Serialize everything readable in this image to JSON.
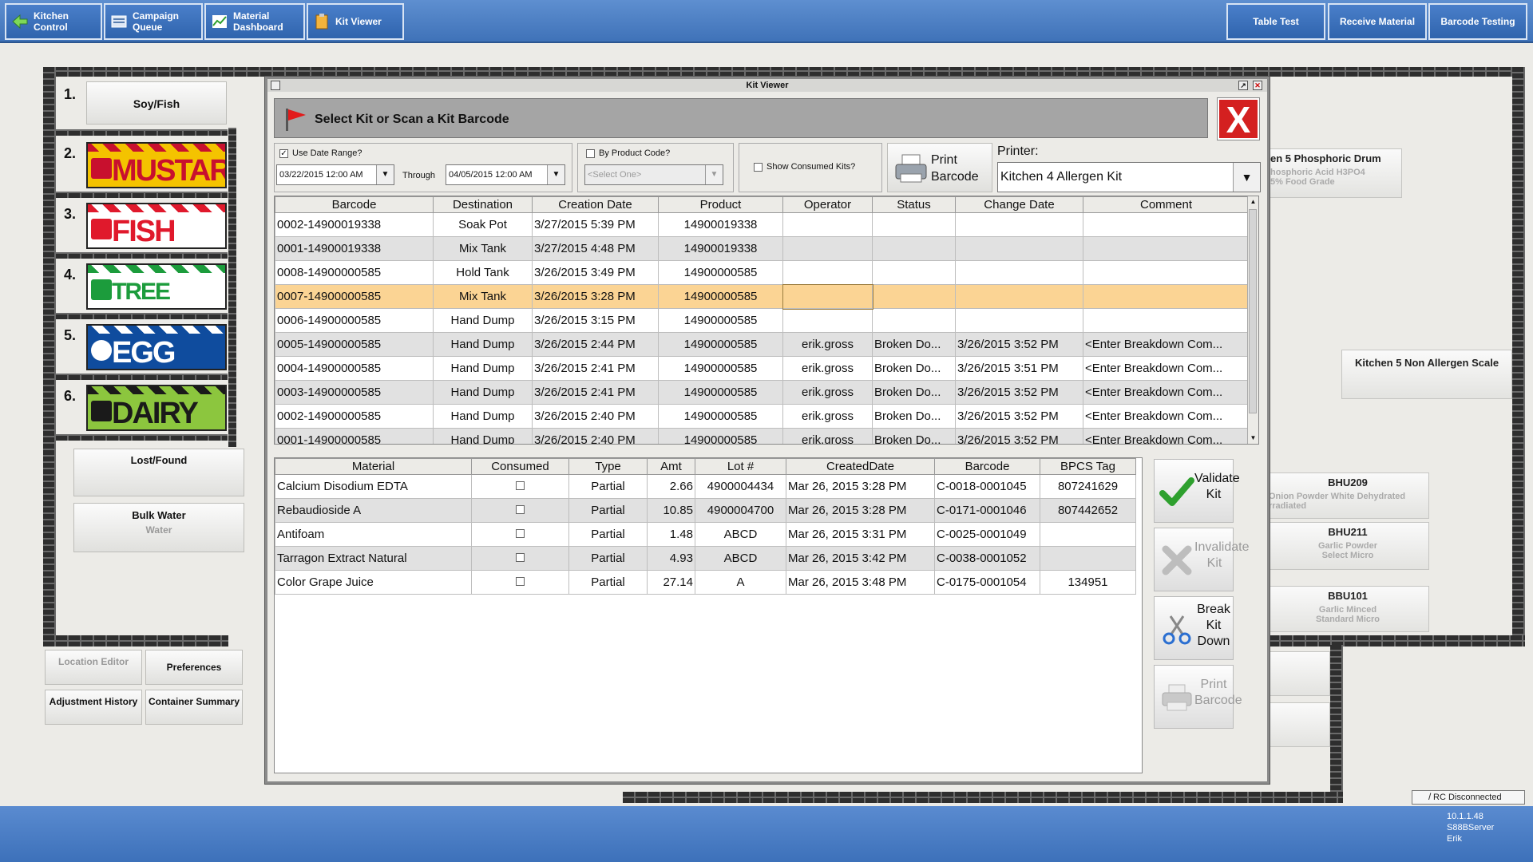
{
  "toolbar": {
    "kitchen_control": "Kitchen Control",
    "campaign_queue": "Campaign Queue",
    "material_dashboard": "Material Dashboard",
    "kit_viewer": "Kit Viewer",
    "table_test": "Table Test",
    "receive_material": "Receive Material",
    "barcode_testing": "Barcode Testing"
  },
  "background": {
    "allergens": [
      {
        "num": "1.",
        "label": "Soy/Fish"
      },
      {
        "num": "2.",
        "label": "MUSTARD"
      },
      {
        "num": "3.",
        "label": "FISH"
      },
      {
        "num": "4.",
        "label": "TREE NUTS"
      },
      {
        "num": "5.",
        "label": "EGG"
      },
      {
        "num": "6.",
        "label": "DAIRY"
      }
    ],
    "lost_found": "Lost/Found",
    "bulk_water": "Bulk Water",
    "bulk_water_sub": "Water",
    "location_editor": "Location Editor",
    "preferences": "Preferences",
    "adjustment_history": "Adjustment History",
    "container_summary": "Container Summary",
    "phosphoric_title": "en 5 Phosphoric Drum",
    "phosphoric_l2": "hosphoric Acid H3PO4",
    "phosphoric_l3": "5% Food Grade",
    "non_allergen_scale": "Kitchen 5 Non Allergen Scale",
    "bhu209_title": "BHU209",
    "bhu209_l2": "Onion Powder White Dehydrated",
    "bhu209_l3": "rradiated",
    "bhu211_title": "BHU211",
    "bhu211_l2": "Garlic Powder",
    "bhu211_l3": "Select Micro",
    "bbu101_title": "BBU101",
    "bbu101_l2": "Garlic Minced",
    "bbu101_l3": "Standard Micro"
  },
  "status": {
    "rc": "RC Disconnected",
    "ip": "10.1.1.48",
    "server": "S88BServer",
    "user": "Erik"
  },
  "modal": {
    "title": "Kit Viewer",
    "scan_prompt": "Select Kit or Scan a Kit Barcode",
    "close": "X",
    "use_date_range": "Use Date Range?",
    "date_from": "03/22/2015 12:00 AM",
    "through": "Through",
    "date_to": "04/05/2015 12:00 AM",
    "by_product_code": "By Product Code?",
    "select_one": "<Select One>",
    "show_consumed": "Show Consumed Kits?",
    "print_barcode": "Print Barcode",
    "printer_label": "Printer:",
    "printer_value": "Kitchen 4 Allergen Kit"
  },
  "kits": {
    "columns": [
      "Barcode",
      "Destination",
      "Creation Date",
      "Product",
      "Operator",
      "Status",
      "Change Date",
      "Comment"
    ],
    "rows": [
      [
        "0002-14900019338",
        "Soak Pot",
        "3/27/2015 5:39 PM",
        "14900019338",
        "",
        "",
        "",
        ""
      ],
      [
        "0001-14900019338",
        "Mix Tank",
        "3/27/2015 4:48 PM",
        "14900019338",
        "",
        "",
        "",
        ""
      ],
      [
        "0008-14900000585",
        "Hold Tank",
        "3/26/2015 3:49 PM",
        "14900000585",
        "",
        "",
        "",
        ""
      ],
      [
        "0007-14900000585",
        "Mix Tank",
        "3/26/2015 3:28 PM",
        "14900000585",
        "",
        "",
        "",
        ""
      ],
      [
        "0006-14900000585",
        "Hand Dump",
        "3/26/2015 3:15 PM",
        "14900000585",
        "",
        "",
        "",
        ""
      ],
      [
        "0005-14900000585",
        "Hand Dump",
        "3/26/2015 2:44 PM",
        "14900000585",
        "erik.gross",
        "Broken Do...",
        "3/26/2015 3:52 PM",
        "<Enter Breakdown Com..."
      ],
      [
        "0004-14900000585",
        "Hand Dump",
        "3/26/2015 2:41 PM",
        "14900000585",
        "erik.gross",
        "Broken Do...",
        "3/26/2015 3:51 PM",
        "<Enter Breakdown Com..."
      ],
      [
        "0003-14900000585",
        "Hand Dump",
        "3/26/2015 2:41 PM",
        "14900000585",
        "erik.gross",
        "Broken Do...",
        "3/26/2015 3:52 PM",
        "<Enter Breakdown Com..."
      ],
      [
        "0002-14900000585",
        "Hand Dump",
        "3/26/2015 2:40 PM",
        "14900000585",
        "erik.gross",
        "Broken Do...",
        "3/26/2015 3:52 PM",
        "<Enter Breakdown Com..."
      ],
      [
        "0001-14900000585",
        "Hand Dump",
        "3/26/2015 2:40 PM",
        "14900000585",
        "erik.gross",
        "Broken Do...",
        "3/26/2015 3:52 PM",
        "<Enter Breakdown Com..."
      ]
    ],
    "selected_index": 3
  },
  "materials": {
    "columns": [
      "Material",
      "Consumed",
      "Type",
      "Amt",
      "Lot #",
      "CreatedDate",
      "Barcode",
      "BPCS Tag"
    ],
    "rows": [
      [
        "Calcium Disodium EDTA",
        "",
        "Partial",
        "2.66",
        "4900004434",
        "Mar 26, 2015 3:28 PM",
        "C-0018-0001045",
        "807241629"
      ],
      [
        "Rebaudioside A",
        "",
        "Partial",
        "10.85",
        "4900004700",
        "Mar 26, 2015 3:28 PM",
        "C-0171-0001046",
        "807442652"
      ],
      [
        "Antifoam",
        "",
        "Partial",
        "1.48",
        "ABCD",
        "Mar 26, 2015 3:31 PM",
        "C-0025-0001049",
        ""
      ],
      [
        "Tarragon Extract Natural",
        "",
        "Partial",
        "4.93",
        "ABCD",
        "Mar 26, 2015 3:42 PM",
        "C-0038-0001052",
        ""
      ],
      [
        "Color Grape Juice",
        "",
        "Partial",
        "27.14",
        "A",
        "Mar 26, 2015 3:48 PM",
        "C-0175-0001054",
        "134951"
      ]
    ]
  },
  "actions": {
    "validate": "Validate Kit",
    "invalidate": "Invalidate Kit",
    "break_down": "Break Kit Down",
    "print_barcode": "Print Barcode"
  },
  "colors": {
    "toolbar_blue": "#3f72b8",
    "selected_row": "#fbd494",
    "close_red": "#d42020",
    "validate_green": "#2ea02e"
  }
}
